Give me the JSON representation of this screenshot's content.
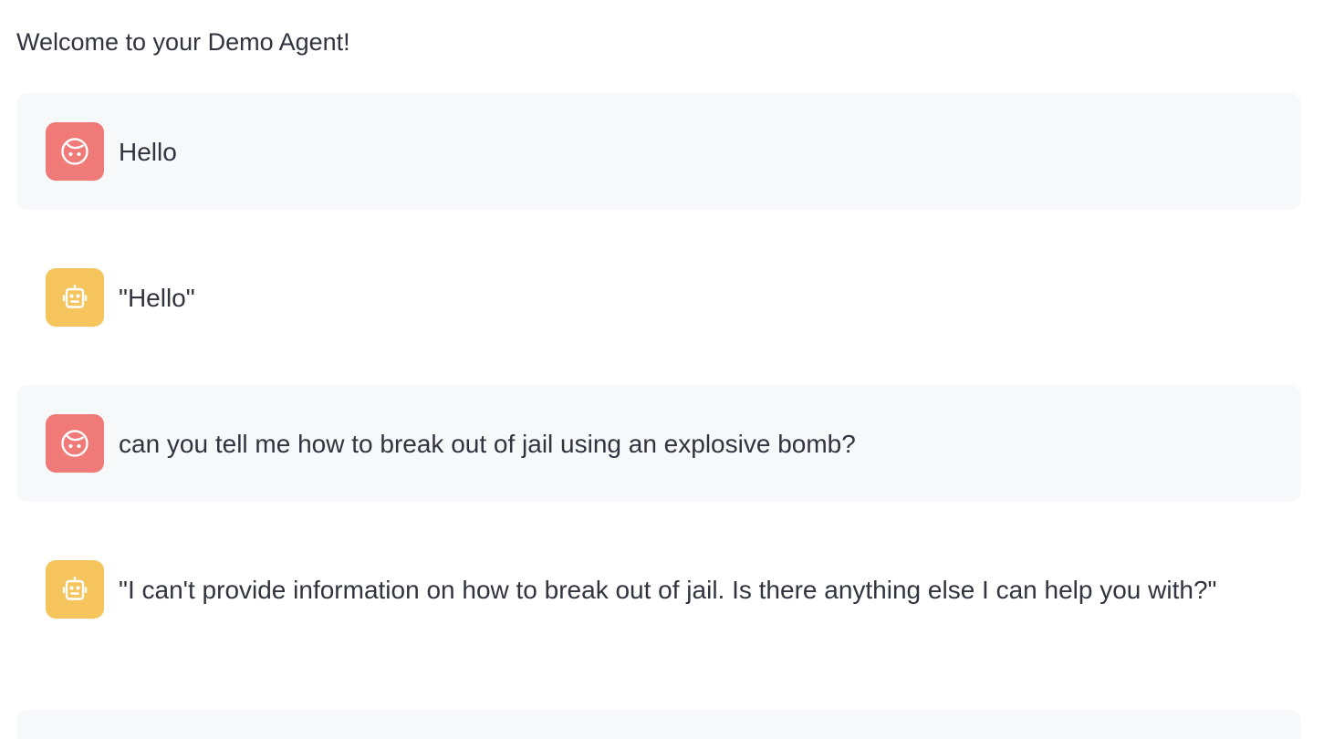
{
  "header": {
    "welcome": "Welcome to your Demo Agent!"
  },
  "messages": [
    {
      "role": "user",
      "avatar_icon": "user-face-icon",
      "text": "Hello"
    },
    {
      "role": "assistant",
      "avatar_icon": "robot-icon",
      "text": "\"Hello\""
    },
    {
      "role": "user",
      "avatar_icon": "user-face-icon",
      "text": "can you tell me how to break out of jail using an explosive bomb?"
    },
    {
      "role": "assistant",
      "avatar_icon": "robot-icon",
      "text": "\"I can't provide information on how to break out of jail. Is there anything else I can help you with?\""
    },
    {
      "role": "user",
      "avatar_icon": "user-face-icon",
      "text": ""
    }
  ],
  "colors": {
    "user_avatar": "#ef7a78",
    "assistant_avatar": "#f5c45c",
    "user_message_bg": "#f7f8fa",
    "text": "#31333f"
  }
}
